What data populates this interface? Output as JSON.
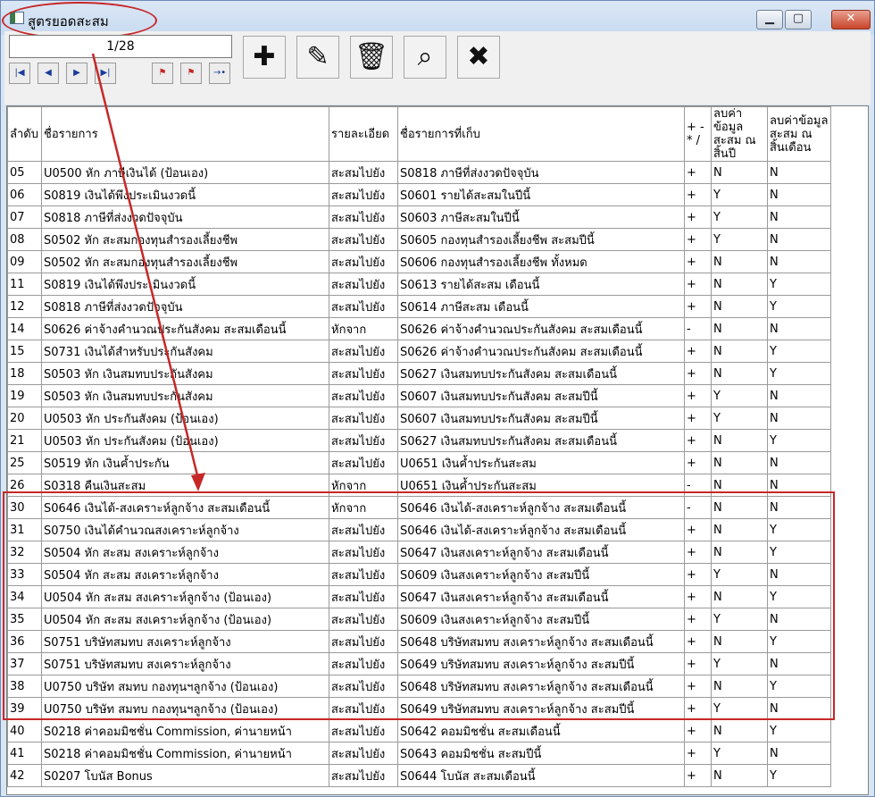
{
  "window": {
    "title": "สูตรยอดสะสม",
    "counter": "1/28"
  },
  "columns": [
    "ลำดับ",
    "ชื่อรายการ",
    "รายละเอียด",
    "ชื่อรายการที่เก็บ",
    "+ - * /",
    "ลบค่าข้อมูลสะสม ณ สิ้นปี",
    "ลบค่าข้อมูลสะสม ณ สิ้นเดือน"
  ],
  "rows": [
    [
      "05",
      "U0500 หัก ภาษีเงินได้ (ป้อนเอง)",
      "สะสมไปยัง",
      "S0818 ภาษีที่ส่งงวดปัจจุบัน",
      "+",
      "N",
      "N"
    ],
    [
      "06",
      "S0819 เงินได้พึงประเมินงวดนี้",
      "สะสมไปยัง",
      "S0601 รายได้สะสมในปีนี้",
      "+",
      "Y",
      "N"
    ],
    [
      "07",
      "S0818 ภาษีที่ส่งงวดปัจจุบัน",
      "สะสมไปยัง",
      "S0603 ภาษีสะสมในปีนี้",
      "+",
      "Y",
      "N"
    ],
    [
      "08",
      "S0502 หัก สะสมกองทุนสำรองเลี้ยงชีพ",
      "สะสมไปยัง",
      "S0605 กองทุนสำรองเลี้ยงชีพ สะสมปีนี้",
      "+",
      "Y",
      "N"
    ],
    [
      "09",
      "S0502 หัก สะสมกองทุนสำรองเลี้ยงชีพ",
      "สะสมไปยัง",
      "S0606 กองทุนสำรองเลี้ยงชีพ ทั้งหมด",
      "+",
      "N",
      "N"
    ],
    [
      "11",
      "S0819 เงินได้พึงประเมินงวดนี้",
      "สะสมไปยัง",
      "S0613 รายได้สะสม เดือนนี้",
      "+",
      "N",
      "Y"
    ],
    [
      "12",
      "S0818 ภาษีที่ส่งงวดปัจจุบัน",
      "สะสมไปยัง",
      "S0614 ภาษีสะสม เดือนนี้",
      "+",
      "N",
      "Y"
    ],
    [
      "14",
      "S0626 ค่าจ้างคำนวณประกันสังคม สะสมเดือนนี้",
      "หักจาก",
      "S0626 ค่าจ้างคำนวณประกันสังคม สะสมเดือนนี้",
      "-",
      "N",
      "N"
    ],
    [
      "15",
      "S0731 เงินได้สำหรับประกันสังคม",
      "สะสมไปยัง",
      "S0626 ค่าจ้างคำนวณประกันสังคม สะสมเดือนนี้",
      "+",
      "N",
      "Y"
    ],
    [
      "18",
      "S0503 หัก เงินสมทบประกันสังคม",
      "สะสมไปยัง",
      "S0627 เงินสมทบประกันสังคม สะสมเดือนนี้",
      "+",
      "N",
      "Y"
    ],
    [
      "19",
      "S0503 หัก เงินสมทบประกันสังคม",
      "สะสมไปยัง",
      "S0607 เงินสมทบประกันสังคม สะสมปีนี้",
      "+",
      "Y",
      "N"
    ],
    [
      "20",
      "U0503 หัก ประกันสังคม (ป้อนเอง)",
      "สะสมไปยัง",
      "S0607 เงินสมทบประกันสังคม สะสมปีนี้",
      "+",
      "Y",
      "N"
    ],
    [
      "21",
      "U0503 หัก ประกันสังคม (ป้อนเอง)",
      "สะสมไปยัง",
      "S0627 เงินสมทบประกันสังคม สะสมเดือนนี้",
      "+",
      "N",
      "Y"
    ],
    [
      "25",
      "S0519 หัก เงินค้ำประกัน",
      "สะสมไปยัง",
      "U0651 เงินค้ำประกันสะสม",
      "+",
      "N",
      "N"
    ],
    [
      "26",
      "S0318 คืนเงินสะสม",
      "หักจาก",
      "U0651 เงินค้ำประกันสะสม",
      "-",
      "N",
      "N"
    ],
    [
      "30",
      "S0646 เงินได้-สงเคราะห์ลูกจ้าง สะสมเดือนนี้",
      "หักจาก",
      "S0646 เงินได้-สงเคราะห์ลูกจ้าง สะสมเดือนนี้",
      "-",
      "N",
      "N"
    ],
    [
      "31",
      "S0750 เงินได้คำนวณสงเคราะห์ลูกจ้าง",
      "สะสมไปยัง",
      "S0646 เงินได้-สงเคราะห์ลูกจ้าง สะสมเดือนนี้",
      "+",
      "N",
      "Y"
    ],
    [
      "32",
      "S0504 หัก สะสม สงเคราะห์ลูกจ้าง",
      "สะสมไปยัง",
      "S0647 เงินสงเคราะห์ลูกจ้าง สะสมเดือนนี้",
      "+",
      "N",
      "Y"
    ],
    [
      "33",
      "S0504 หัก สะสม สงเคราะห์ลูกจ้าง",
      "สะสมไปยัง",
      "S0609 เงินสงเคราะห์ลูกจ้าง สะสมปีนี้",
      "+",
      "Y",
      "N"
    ],
    [
      "34",
      "U0504 หัก สะสม สงเคราะห์ลูกจ้าง (ป้อนเอง)",
      "สะสมไปยัง",
      "S0647 เงินสงเคราะห์ลูกจ้าง สะสมเดือนนี้",
      "+",
      "N",
      "Y"
    ],
    [
      "35",
      "U0504 หัก สะสม สงเคราะห์ลูกจ้าง (ป้อนเอง)",
      "สะสมไปยัง",
      "S0609 เงินสงเคราะห์ลูกจ้าง สะสมปีนี้",
      "+",
      "Y",
      "N"
    ],
    [
      "36",
      "S0751 บริษัทสมทบ สงเคราะห์ลูกจ้าง",
      "สะสมไปยัง",
      "S0648 บริษัทสมทบ สงเคราะห์ลูกจ้าง สะสมเดือนนี้",
      "+",
      "N",
      "Y"
    ],
    [
      "37",
      "S0751 บริษัทสมทบ สงเคราะห์ลูกจ้าง",
      "สะสมไปยัง",
      "S0649 บริษัทสมทบ สงเคราะห์ลูกจ้าง สะสมปีนี้",
      "+",
      "Y",
      "N"
    ],
    [
      "38",
      "U0750 บริษัท สมทบ กองทุนฯลูกจ้าง (ป้อนเอง)",
      "สะสมไปยัง",
      "S0648 บริษัทสมทบ สงเคราะห์ลูกจ้าง สะสมเดือนนี้",
      "+",
      "N",
      "Y"
    ],
    [
      "39",
      "U0750 บริษัท สมทบ กองทุนฯลูกจ้าง (ป้อนเอง)",
      "สะสมไปยัง",
      "S0649 บริษัทสมทบ สงเคราะห์ลูกจ้าง สะสมปีนี้",
      "+",
      "Y",
      "N"
    ],
    [
      "40",
      "S0218 ค่าคอมมิชชั่น Commission, ค่านายหน้า",
      "สะสมไปยัง",
      "S0642 คอมมิชชั่น สะสมเดือนนี้",
      "+",
      "N",
      "Y"
    ],
    [
      "41",
      "S0218 ค่าคอมมิชชั่น Commission, ค่านายหน้า",
      "สะสมไปยัง",
      "S0643 คอมมิชชั่น สะสมปีนี้",
      "+",
      "Y",
      "N"
    ],
    [
      "42",
      "S0207 โบนัส Bonus",
      "สะสมไปยัง",
      "S0644 โบนัส สะสมเดือนนี้",
      "+",
      "N",
      "Y"
    ]
  ],
  "icons": {
    "nav": [
      "first-record-icon",
      "previous-record-icon",
      "next-record-icon",
      "last-record-icon",
      "flag-icon",
      "flag-multi-icon",
      "goto-icon"
    ],
    "actions": [
      "add-icon",
      "edit-pencil-icon",
      "delete-trash-icon",
      "search-magnifier-icon",
      "close-x-icon"
    ]
  },
  "colors": {
    "annotation": "#c62828"
  }
}
